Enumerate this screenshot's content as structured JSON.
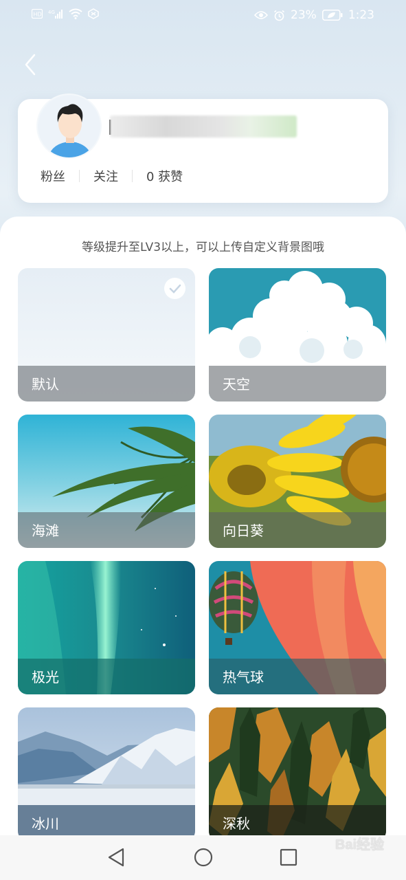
{
  "status_bar": {
    "battery_percent": "23%",
    "time": "1:23"
  },
  "profile": {
    "stats": [
      {
        "label": "粉丝"
      },
      {
        "label": "关注"
      },
      {
        "label": "0 获赞"
      }
    ]
  },
  "sheet": {
    "hint": "等级提升至LV3以上，可以上传自定义背景图哦",
    "backgrounds": [
      {
        "label": "默认",
        "selected": true
      },
      {
        "label": "天空",
        "selected": false
      },
      {
        "label": "海滩",
        "selected": false
      },
      {
        "label": "向日葵",
        "selected": false
      },
      {
        "label": "极光",
        "selected": false
      },
      {
        "label": "热气球",
        "selected": false
      },
      {
        "label": "冰川",
        "selected": false
      },
      {
        "label": "深秋",
        "selected": false
      }
    ]
  },
  "nav_bar": {
    "buttons": [
      "back-triangle-icon",
      "home-circle-icon",
      "recents-square-icon"
    ]
  },
  "watermark": "Bai经验"
}
